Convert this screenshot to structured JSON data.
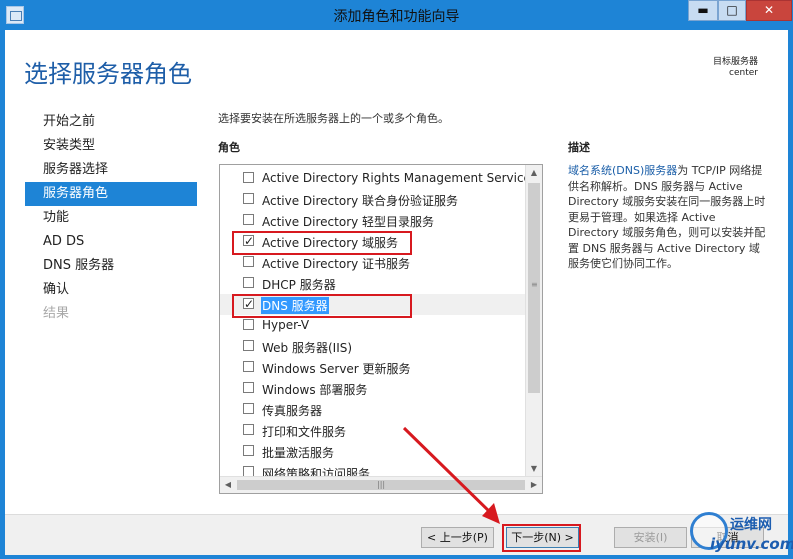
{
  "window": {
    "title": "添加角色和功能向导",
    "min_glyph": "▬",
    "max_glyph": "□",
    "close_glyph": "✕"
  },
  "header": {
    "page_title": "选择服务器角色",
    "target_label": "目标服务器",
    "target_value": "center"
  },
  "nav": {
    "items": [
      {
        "label": "开始之前",
        "state": "normal"
      },
      {
        "label": "安装类型",
        "state": "normal"
      },
      {
        "label": "服务器选择",
        "state": "normal"
      },
      {
        "label": "服务器角色",
        "state": "active"
      },
      {
        "label": "功能",
        "state": "normal"
      },
      {
        "label": "AD DS",
        "state": "normal"
      },
      {
        "label": "DNS 服务器",
        "state": "normal"
      },
      {
        "label": "确认",
        "state": "normal"
      },
      {
        "label": "结果",
        "state": "disabled"
      }
    ]
  },
  "main": {
    "instruction": "选择要安装在所选服务器上的一个或多个角色。",
    "roles_header": "角色",
    "description_header": "描述",
    "roles": [
      {
        "label": "Active Directory Rights Management Services",
        "checked": false
      },
      {
        "label": "Active Directory 联合身份验证服务",
        "checked": false
      },
      {
        "label": "Active Directory 轻型目录服务",
        "checked": false
      },
      {
        "label": "Active Directory 域服务",
        "checked": true
      },
      {
        "label": "Active Directory 证书服务",
        "checked": false
      },
      {
        "label": "DHCP 服务器",
        "checked": false
      },
      {
        "label": "DNS 服务器",
        "checked": true
      },
      {
        "label": "Hyper-V",
        "checked": false
      },
      {
        "label": "Web 服务器(IIS)",
        "checked": false
      },
      {
        "label": "Windows Server 更新服务",
        "checked": false
      },
      {
        "label": "Windows 部署服务",
        "checked": false
      },
      {
        "label": "传真服务器",
        "checked": false
      },
      {
        "label": "打印和文件服务",
        "checked": false
      },
      {
        "label": "批量激活服务",
        "checked": false
      },
      {
        "label": "网络策略和访问服务",
        "checked": false
      }
    ],
    "description": {
      "link": "域名系统(DNS)服务器",
      "text": "为 TCP/IP 网络提供名称解析。DNS 服务器与 Active Directory 域服务安装在同一服务器上时更易于管理。如果选择 Active Directory 域服务角色，则可以安装并配置 DNS 服务器与 Active Directory 域服务使它们协同工作。"
    }
  },
  "footer": {
    "prev_label": "< 上一步(P)",
    "next_label": "下一步(N) >",
    "install_label": "安装(I)",
    "cancel_label": "取消"
  },
  "watermark": {
    "line1": "运维网",
    "line2": "iyunv.com"
  },
  "colors": {
    "accent": "#1e84d6",
    "annotation": "#d7191f"
  }
}
